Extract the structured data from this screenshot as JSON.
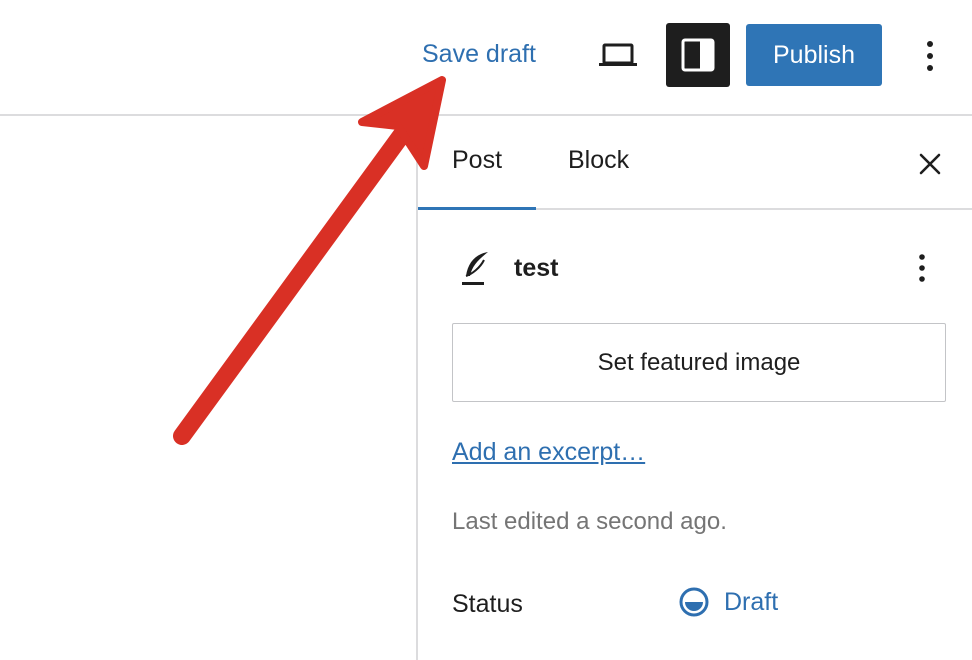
{
  "toolbar": {
    "save_draft_label": "Save draft",
    "publish_label": "Publish",
    "preview_icon": "laptop-icon",
    "sidebar_icon": "sidebar-toggle-icon",
    "more_icon": "vertical-ellipsis-icon"
  },
  "sidebar": {
    "tabs": [
      {
        "label": "Post",
        "active": true
      },
      {
        "label": "Block",
        "active": false
      }
    ],
    "close_icon": "close-icon",
    "post": {
      "icon": "feather-icon",
      "title": "test",
      "more_icon": "vertical-ellipsis-icon"
    },
    "featured_image_label": "Set featured image",
    "excerpt_link": "Add an excerpt…",
    "last_edited": "Last edited a second ago.",
    "status": {
      "label": "Status",
      "value": "Draft",
      "icon": "draft-status-icon"
    }
  },
  "colors": {
    "accent": "#2f75b6",
    "link": "#2e6fb0",
    "dark": "#1e1e1e",
    "muted": "#757575",
    "annotation_arrow": "#d93025"
  }
}
